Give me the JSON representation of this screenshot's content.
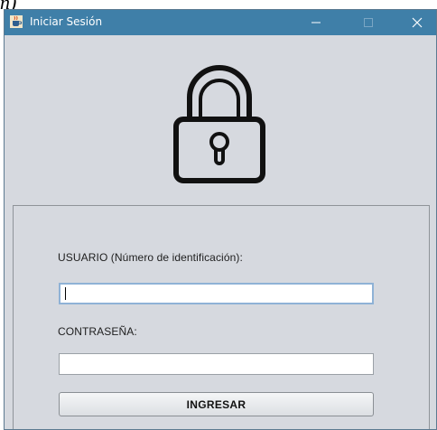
{
  "caption_fragment": "n)",
  "window": {
    "title": "Iniciar Sesión",
    "titlebar_color": "#3f7fa8",
    "background_color": "#d6d9df",
    "icons": {
      "app": "java-coffee-cup-icon",
      "minimize": "minimize-icon",
      "maximize": "maximize-icon",
      "close": "close-icon",
      "hero": "padlock-icon"
    }
  },
  "form": {
    "user_label": "USUARIO (Número de identificación):",
    "user_value": "",
    "password_label": "CONTRASEÑA:",
    "password_value": "",
    "submit_label": "INGRESAR"
  }
}
